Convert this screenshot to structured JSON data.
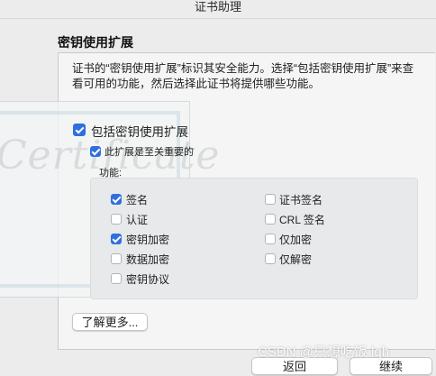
{
  "window": {
    "title": "证书助理"
  },
  "section": {
    "heading": "密钥使用扩展"
  },
  "description": "证书的“密钥使用扩展”标识其安全能力。选择“包括密钥使用扩展”来查看可用的功能，然后选择此证书将提供哪些功能。",
  "background_script": "Certificate",
  "include_extension": {
    "label": "包括密钥使用扩展",
    "checked": true
  },
  "critical_extension": {
    "label": "此扩展是至关重要的",
    "checked": true
  },
  "capabilities": {
    "heading": "功能:",
    "left": [
      {
        "label": "签名",
        "checked": true
      },
      {
        "label": "认证",
        "checked": false
      },
      {
        "label": "密钥加密",
        "checked": true
      },
      {
        "label": "数据加密",
        "checked": false
      },
      {
        "label": "密钥协议",
        "checked": false
      }
    ],
    "right": [
      {
        "label": "证书签名",
        "checked": false
      },
      {
        "label": "CRL 签名",
        "checked": false
      },
      {
        "label": "仅加密",
        "checked": false
      },
      {
        "label": "仅解密",
        "checked": false
      }
    ]
  },
  "buttons": {
    "learn_more": "了解更多...",
    "back": "返回",
    "continue": "继续"
  },
  "watermark": "CSDN @只想吃饭 lqh",
  "colors": {
    "accent": "#2f6fde"
  }
}
